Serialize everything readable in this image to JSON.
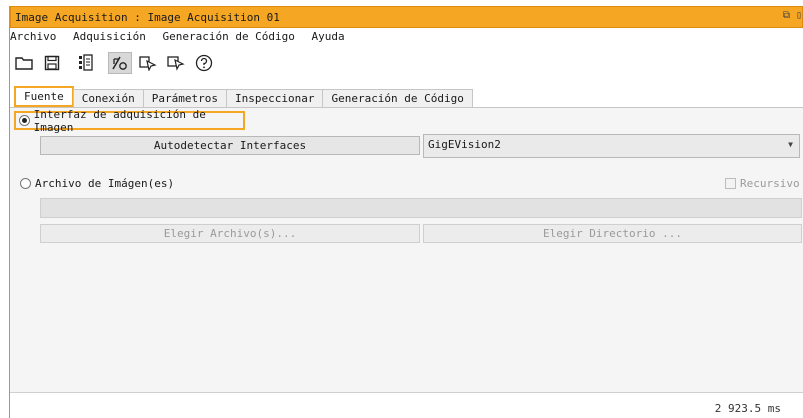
{
  "window": {
    "title": "Image Acquisition : Image Acquisition 01",
    "controls": "⧉ ▯"
  },
  "menu": [
    "Archivo",
    "Adquisición",
    "Generación de Código",
    "Ayuda"
  ],
  "toolbar": {
    "icons": [
      "open-folder-icon",
      "save-icon",
      "image-acquisition-icon",
      "toggle-connect-icon",
      "snap-icon",
      "live-icon",
      "help-icon"
    ],
    "active": "toggle-connect-icon"
  },
  "tabs": [
    "Fuente",
    "Conexión",
    "Parámetros",
    "Inspeccionar",
    "Generación de Código"
  ],
  "selected_tab": "Fuente",
  "source": {
    "interface_radio": "Interfaz de adquisición de Imagen",
    "interface_selected": true,
    "autodetect_button": "Autodetectar Interfaces",
    "interface_value": "GigEVision2",
    "file_radio": "Archivo de Imágen(es)",
    "file_selected": false,
    "recursive_label": "Recursivo",
    "recursive_checked": false,
    "file_path": "",
    "choose_files_button": "Elegir Archivo(s)...",
    "choose_dir_button": "Elegir Directorio ..."
  },
  "status": {
    "time": "2  923.5 ms"
  },
  "colors": {
    "accent": "#f5a623",
    "panel": "#f5f5f5"
  }
}
